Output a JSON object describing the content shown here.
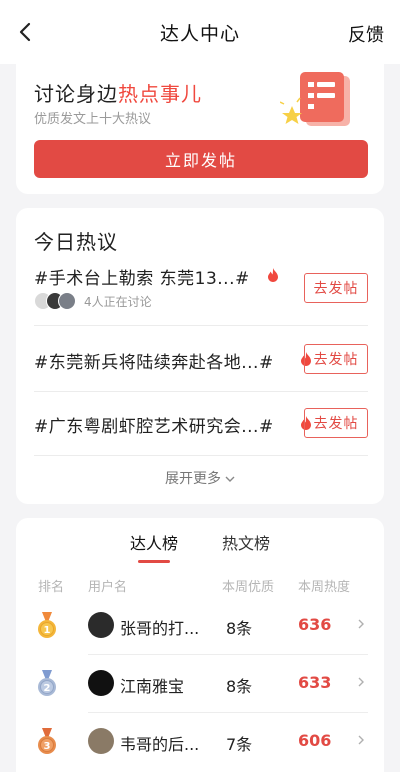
{
  "header": {
    "title": "达人中心",
    "feedback_label": "反馈"
  },
  "hero": {
    "title_prefix": "讨论身边",
    "title_hot": "热点事儿",
    "subtitle": "优质发文上十大热议",
    "post_button": "立即发帖"
  },
  "today": {
    "title": "今日热议",
    "topics": [
      {
        "text": "#手术台上勒索 东莞13...#",
        "button": "去发帖",
        "meta": "4人正在讨论"
      },
      {
        "text": "#东莞新兵将陆续奔赴各地...#",
        "button": "去发帖"
      },
      {
        "text": "#广东粤剧虾腔艺术研究会...#",
        "button": "去发帖"
      }
    ],
    "expand_label": "展开更多"
  },
  "rank": {
    "tabs": [
      {
        "label": "达人榜",
        "active": true
      },
      {
        "label": "热文榜",
        "active": false
      }
    ],
    "columns": {
      "rank": "排名",
      "user": "用户名",
      "quality": "本周优质",
      "heat": "本周热度"
    },
    "rows": [
      {
        "rank": "1",
        "name": "张哥的打...",
        "quality": "8条",
        "heat": "636"
      },
      {
        "rank": "2",
        "name": "江南雅宝",
        "quality": "8条",
        "heat": "633"
      },
      {
        "rank": "3",
        "name": "韦哥的后...",
        "quality": "7条",
        "heat": "606"
      }
    ]
  },
  "colors": {
    "accent": "#e24a44",
    "hot_text": "#f0483e",
    "gold": "#f4b63a",
    "silver": "#a8b9d6",
    "bronze": "#e88c4c"
  }
}
